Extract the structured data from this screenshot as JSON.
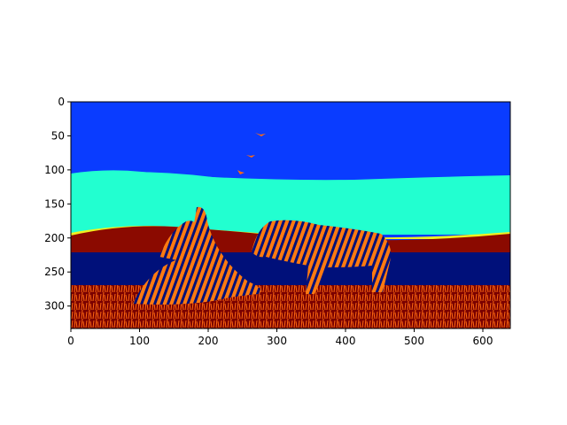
{
  "figure": {
    "kind": "image-plot",
    "colormap": "jet",
    "image_width": 640,
    "image_height": 333,
    "x_ticks": [
      "0",
      "100",
      "200",
      "300",
      "400",
      "500",
      "600"
    ],
    "y_ticks": [
      "0",
      "50",
      "100",
      "150",
      "200",
      "250",
      "300"
    ],
    "colors": {
      "sky": "#0a3cff",
      "haze": "#22ffd0",
      "ridge": "#f0f020",
      "foliage_dark": "#8b0a00",
      "ground": "#00107a",
      "grass_dark": "#7a0000",
      "highlight": "#ff6a10",
      "stripe": "#ff7a10",
      "white": "#ffffff"
    }
  }
}
